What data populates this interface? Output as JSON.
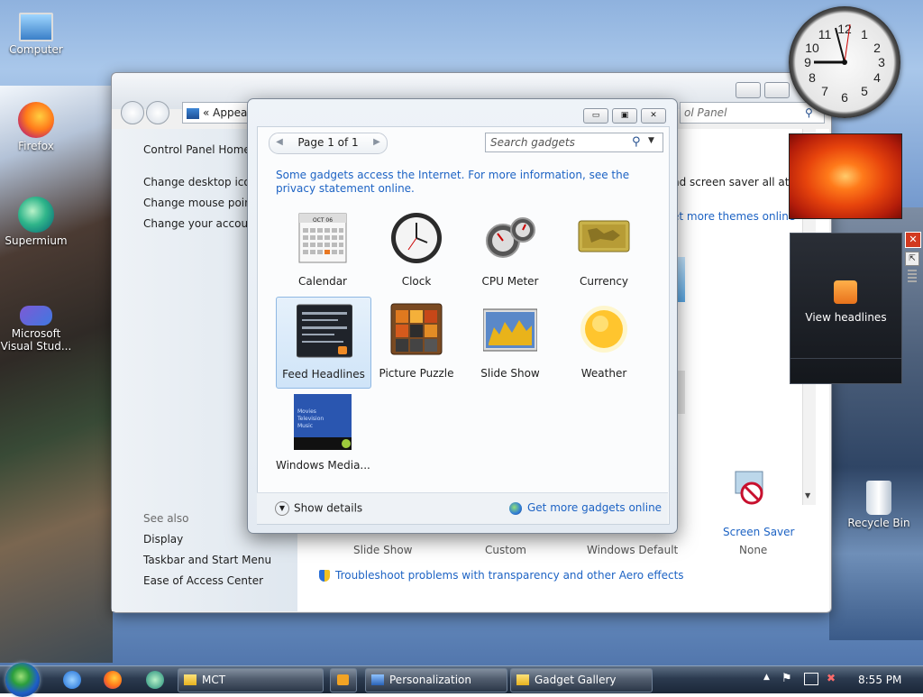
{
  "desktop": {
    "icons": [
      {
        "label": "Computer"
      },
      {
        "label": "Firefox"
      },
      {
        "label": "Supermium"
      },
      {
        "label": "Microsoft\nVisual Stud..."
      },
      {
        "label": "Recycle Bin"
      }
    ]
  },
  "control_panel": {
    "address_chevron": "«",
    "address_text": "Appea",
    "search_placeholder": "ol Panel",
    "left_nav": {
      "home": "Control Panel Home",
      "items": [
        "Change desktop icons",
        "Change mouse pointers",
        "Change your account picture"
      ],
      "see_also_heading": "See also",
      "see_also": [
        "Display",
        "Taskbar and Start Menu",
        "Ease of Access Center"
      ]
    },
    "main_fragments": {
      "desc": "nd screen saver all at once",
      "get_more_themes": "et more themes online",
      "screen_saver_label": "Screen Saver",
      "screen_saver_value": "None",
      "slide_show": "Slide Show",
      "custom": "Custom",
      "windows_default": "Windows Default",
      "troubleshoot": "Troubleshoot problems with transparency and other Aero effects"
    }
  },
  "gadget_gallery": {
    "page_label": "Page 1 of 1",
    "search_placeholder": "Search gadgets",
    "info_text": "Some gadgets access the Internet.  For more information, see the privacy statement online.",
    "gadgets": [
      {
        "name": "Calendar",
        "calendar_month": "OCT 06"
      },
      {
        "name": "Clock"
      },
      {
        "name": "CPU Meter"
      },
      {
        "name": "Currency"
      },
      {
        "name": "Feed Headlines",
        "selected": true
      },
      {
        "name": "Picture Puzzle"
      },
      {
        "name": "Slide Show"
      },
      {
        "name": "Weather"
      },
      {
        "name": "Windows Media...",
        "menu": [
          "Movies",
          "Television",
          "Music"
        ]
      }
    ],
    "show_details": "Show details",
    "get_more": "Get more gadgets online"
  },
  "sidebar": {
    "feed_label": "View headlines"
  },
  "taskbar": {
    "buttons": [
      {
        "label": "MCT"
      },
      {
        "label": "Personalization"
      },
      {
        "label": "Gadget Gallery"
      }
    ],
    "time": "8:55 PM"
  },
  "colors": {
    "link": "#1d63c4",
    "selection": "#cfe4f8"
  }
}
